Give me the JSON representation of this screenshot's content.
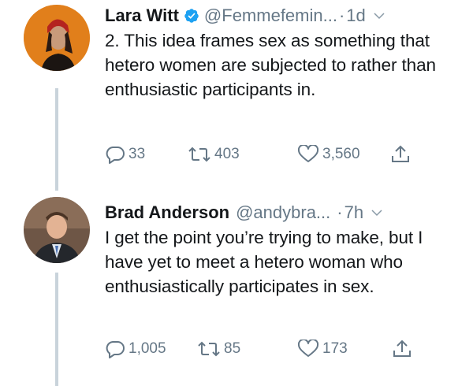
{
  "tweets": [
    {
      "name": "Lara Witt",
      "handle": "@Femmefemin...",
      "separator": "·",
      "time": "1d",
      "text": "2. This idea frames sex as something that hetero women are subjected to rather than enthusiastic participants in.",
      "reply_count": "33",
      "retweet_count": "403",
      "like_count": "3,560",
      "verified": true
    },
    {
      "name": "Brad Anderson",
      "handle": "@andybra...",
      "separator": "·",
      "time": "7h",
      "text": "I get the point you’re trying to make, but I have yet to meet a hetero woman who enthusiastically participates in sex.",
      "reply_count": "1,005",
      "retweet_count": "85",
      "like_count": "173",
      "verified": false
    }
  ],
  "colors": {
    "text": "#14171a",
    "secondary": "#657786",
    "verified": "#1da1f2",
    "thread_line": "#c9d3db"
  }
}
